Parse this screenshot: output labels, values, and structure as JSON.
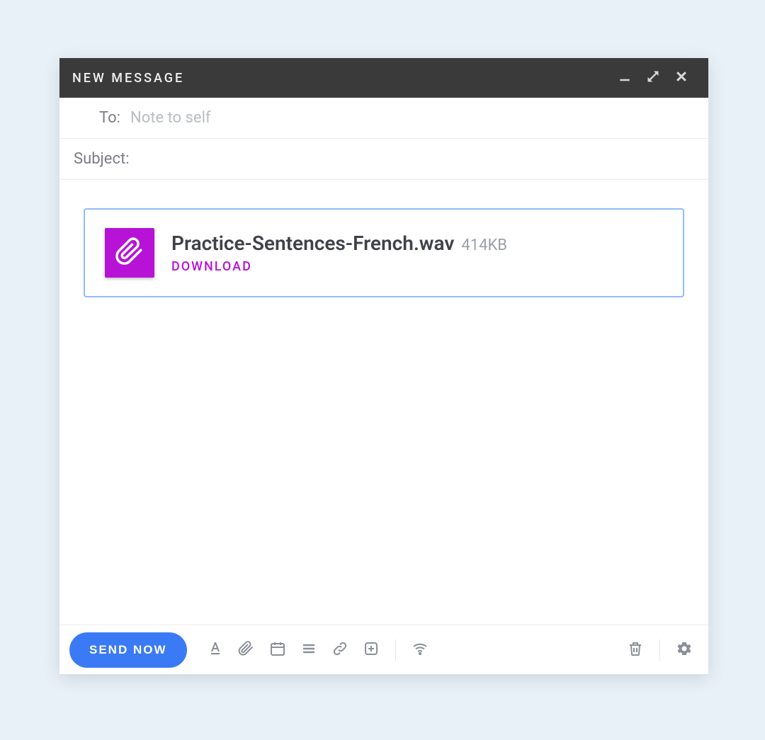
{
  "window": {
    "title": "NEW MESSAGE"
  },
  "fields": {
    "to_label": "To:",
    "to_placeholder": "Note to self",
    "subject_label": "Subject:"
  },
  "attachment": {
    "filename": "Practice-Sentences-French.wav",
    "size": "414KB",
    "download_label": "DOWNLOAD",
    "icon_color": "#b713d6"
  },
  "toolbar": {
    "send_label": "SEND NOW"
  }
}
